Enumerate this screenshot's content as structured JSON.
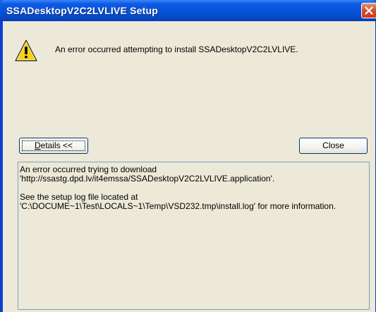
{
  "window": {
    "title": "SSADesktopV2C2LVLIVE Setup",
    "close_icon": "close-icon"
  },
  "message": {
    "icon": "warning-icon",
    "text": "An error occurred attempting to install SSADesktopV2C2LVLIVE."
  },
  "buttons": {
    "details_mnemonic": "D",
    "details_rest": "etails <<",
    "close_label": "Close"
  },
  "details": {
    "line1": "An error occurred trying to download",
    "line2": "'http://ssastg.dpd.lv/it4emssa/SSADesktopV2C2LVLIVE.application'.",
    "line3": "See the setup log file located at",
    "line4": "'C:\\DOCUME~1\\Test\\LOCALS~1\\Temp\\VSD232.tmp\\install.log' for more information."
  },
  "colors": {
    "titlebar": "#0652d8",
    "dialog_background": "#ece9d8",
    "close_button": "#d9512f",
    "warning_fill": "#f7d21c"
  }
}
